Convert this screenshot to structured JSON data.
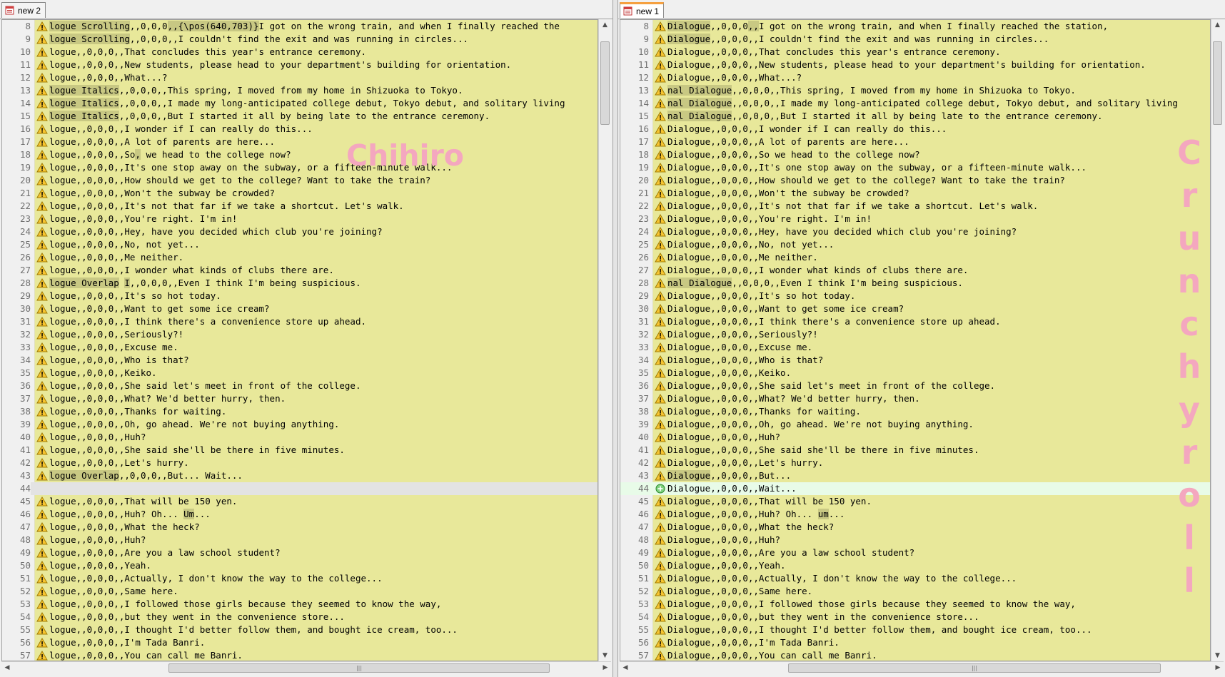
{
  "left": {
    "tab_label": "new 2",
    "watermark": "Chihiro",
    "lines": [
      {
        "n": "8",
        "segs": [
          [
            "logue Scrolling",
            1
          ],
          [
            ",,0,0,0",
            0
          ],
          [
            ",,{\\pos(640,703)}",
            1
          ],
          [
            "I got on the wrong train, and when I finally reached the",
            0
          ]
        ]
      },
      {
        "n": "9",
        "segs": [
          [
            "logue Scrolling",
            1
          ],
          [
            ",,0,0,0,,I couldn't find the exit and was running in circles...",
            0
          ]
        ]
      },
      {
        "n": "10",
        "segs": [
          [
            "logue,,0,0,0,,That concludes this year's entrance ceremony.",
            0
          ]
        ]
      },
      {
        "n": "11",
        "segs": [
          [
            "logue,,0,0,0,,New students, please head to your department's building for orientation.",
            0
          ]
        ]
      },
      {
        "n": "12",
        "segs": [
          [
            "logue,,0,0,0,,What...?",
            0
          ]
        ]
      },
      {
        "n": "13",
        "segs": [
          [
            "logue Italics",
            1
          ],
          [
            ",,0,0,0,,This spring, I moved from my home in Shizuoka to Tokyo.",
            0
          ]
        ]
      },
      {
        "n": "14",
        "segs": [
          [
            "logue Italics",
            1
          ],
          [
            ",,0,0,0,,I made my long-anticipated college debut, Tokyo debut, and solitary living",
            0
          ]
        ]
      },
      {
        "n": "15",
        "segs": [
          [
            "logue Italics",
            1
          ],
          [
            ",,0,0,0,,But I started it all by being late to the entrance ceremony.",
            0
          ]
        ]
      },
      {
        "n": "16",
        "segs": [
          [
            "logue,,0,0,0,,I wonder if I can really do this...",
            0
          ]
        ]
      },
      {
        "n": "17",
        "segs": [
          [
            "logue,,0,0,0,,A lot of parents are here...",
            0
          ]
        ]
      },
      {
        "n": "18",
        "segs": [
          [
            "logue,,0,0,0,,So",
            0
          ],
          [
            ",",
            1
          ],
          [
            " we head to the college now?",
            0
          ]
        ]
      },
      {
        "n": "19",
        "segs": [
          [
            "logue,,0,0,0,,It's one stop away on the subway, or a fifteen-minute walk...",
            0
          ]
        ]
      },
      {
        "n": "20",
        "segs": [
          [
            "logue,,0,0,0,,How should we get to the college? Want to take the train?",
            0
          ]
        ]
      },
      {
        "n": "21",
        "segs": [
          [
            "logue,,0,0,0,,Won't the subway be crowded?",
            0
          ]
        ]
      },
      {
        "n": "22",
        "segs": [
          [
            "logue,,0,0,0,,It's not that far if we take a shortcut. Let's walk.",
            0
          ]
        ]
      },
      {
        "n": "23",
        "segs": [
          [
            "logue,,0,0,0,,You're right. I'm in!",
            0
          ]
        ]
      },
      {
        "n": "24",
        "segs": [
          [
            "logue,,0,0,0,,Hey, have you decided which club you're joining?",
            0
          ]
        ]
      },
      {
        "n": "25",
        "segs": [
          [
            "logue,,0,0,0,,No, not yet...",
            0
          ]
        ]
      },
      {
        "n": "26",
        "segs": [
          [
            "logue,,0,0,0,,Me neither.",
            0
          ]
        ]
      },
      {
        "n": "27",
        "segs": [
          [
            "logue,,0,0,0,,I wonder what kinds of clubs there are.",
            0
          ]
        ]
      },
      {
        "n": "28",
        "segs": [
          [
            "logue Overlap",
            1
          ],
          [
            " ",
            0
          ],
          [
            "I",
            1
          ],
          [
            ",,0,0,0,,Even I think I'm being suspicious.",
            0
          ]
        ]
      },
      {
        "n": "29",
        "segs": [
          [
            "logue,,0,0,0,,It's so hot today.",
            0
          ]
        ]
      },
      {
        "n": "30",
        "segs": [
          [
            "logue,,0,0,0,,Want to get some ice cream?",
            0
          ]
        ]
      },
      {
        "n": "31",
        "segs": [
          [
            "logue,,0,0,0,,I think there's a convenience store up ahead.",
            0
          ]
        ]
      },
      {
        "n": "32",
        "segs": [
          [
            "logue,,0,0,0,,Seriously?!",
            0
          ]
        ]
      },
      {
        "n": "33",
        "segs": [
          [
            "logue,,0,0,0,,Excuse me.",
            0
          ]
        ]
      },
      {
        "n": "34",
        "segs": [
          [
            "logue,,0,0,0,,Who is that?",
            0
          ]
        ]
      },
      {
        "n": "35",
        "segs": [
          [
            "logue,,0,0,0,,Keiko.",
            0
          ]
        ]
      },
      {
        "n": "36",
        "segs": [
          [
            "logue,,0,0,0,,She said let's meet in front of the college.",
            0
          ]
        ]
      },
      {
        "n": "37",
        "segs": [
          [
            "logue,,0,0,0,,What? We'd better hurry, then.",
            0
          ]
        ]
      },
      {
        "n": "38",
        "segs": [
          [
            "logue,,0,0,0,,Thanks for waiting.",
            0
          ]
        ]
      },
      {
        "n": "39",
        "segs": [
          [
            "logue,,0,0,0,,Oh, go ahead. We're not buying anything.",
            0
          ]
        ]
      },
      {
        "n": "40",
        "segs": [
          [
            "logue,,0,0,0,,Huh?",
            0
          ]
        ]
      },
      {
        "n": "41",
        "segs": [
          [
            "logue,,0,0,0,,She said she'll be there in five minutes.",
            0
          ]
        ]
      },
      {
        "n": "42",
        "segs": [
          [
            "logue,,0,0,0,,Let's hurry.",
            0
          ]
        ]
      },
      {
        "n": "43",
        "segs": [
          [
            "logue Overlap",
            1
          ],
          [
            ",,0,0,0,,But... Wait...",
            0
          ]
        ]
      },
      {
        "n": "44",
        "kind": "empty",
        "segs": []
      },
      {
        "n": "45",
        "segs": [
          [
            "logue,,0,0,0,,That will be 150 yen.",
            0
          ]
        ]
      },
      {
        "n": "46",
        "segs": [
          [
            "logue,,0,0,0,,Huh? Oh... ",
            0
          ],
          [
            "Um",
            1
          ],
          [
            "...",
            0
          ]
        ]
      },
      {
        "n": "47",
        "segs": [
          [
            "logue,,0,0,0,,What the heck?",
            0
          ]
        ]
      },
      {
        "n": "48",
        "segs": [
          [
            "logue,,0,0,0,,Huh?",
            0
          ]
        ]
      },
      {
        "n": "49",
        "segs": [
          [
            "logue,,0,0,0,,Are you a law school student?",
            0
          ]
        ]
      },
      {
        "n": "50",
        "segs": [
          [
            "logue,,0,0,0,,Yeah.",
            0
          ]
        ]
      },
      {
        "n": "51",
        "segs": [
          [
            "logue,,0,0,0,,Actually, I don't know the way to the college...",
            0
          ]
        ]
      },
      {
        "n": "52",
        "segs": [
          [
            "logue,,0,0,0,,Same here.",
            0
          ]
        ]
      },
      {
        "n": "53",
        "segs": [
          [
            "logue,,0,0,0,,I followed those girls because they seemed to know the way,",
            0
          ]
        ]
      },
      {
        "n": "54",
        "segs": [
          [
            "logue,,0,0,0,,but they went in the convenience store...",
            0
          ]
        ]
      },
      {
        "n": "55",
        "segs": [
          [
            "logue,,0,0,0,,I thought I'd better follow them, and bought ice cream, too...",
            0
          ]
        ]
      },
      {
        "n": "56",
        "segs": [
          [
            "logue,,0,0,0,,I'm Tada Banri.",
            0
          ]
        ]
      },
      {
        "n": "57",
        "segs": [
          [
            "logue,,0,0,0,,You can call me Banri.",
            0
          ]
        ]
      }
    ]
  },
  "right": {
    "tab_label": "new 1",
    "watermark": [
      "C",
      "r",
      "u",
      "n",
      "c",
      "h",
      "y",
      "r",
      "o",
      "l",
      "l"
    ],
    "lines": [
      {
        "n": "8",
        "segs": [
          [
            "Dialogue",
            1
          ],
          [
            ",,0,0,0",
            0
          ],
          [
            ",,",
            1
          ],
          [
            "I got on the wrong train, and when I finally reached the station,",
            0
          ]
        ]
      },
      {
        "n": "9",
        "segs": [
          [
            "Dialogue",
            1
          ],
          [
            ",,0,0,0,,I couldn't find the exit and was running in circles...",
            0
          ]
        ]
      },
      {
        "n": "10",
        "segs": [
          [
            "Dialogue,,0,0,0,,That concludes this year's entrance ceremony.",
            0
          ]
        ]
      },
      {
        "n": "11",
        "segs": [
          [
            "Dialogue,,0,0,0,,New students, please head to your department's building for orientation.",
            0
          ]
        ]
      },
      {
        "n": "12",
        "segs": [
          [
            "Dialogue,,0,0,0,,What...?",
            0
          ]
        ]
      },
      {
        "n": "13",
        "segs": [
          [
            "nal Dialogue",
            1
          ],
          [
            ",,0,0,0,,This spring, I moved from my home in Shizuoka to Tokyo.",
            0
          ]
        ]
      },
      {
        "n": "14",
        "segs": [
          [
            "nal Dialogue",
            1
          ],
          [
            ",,0,0,0,,I made my long-anticipated college debut, Tokyo debut, and solitary living",
            0
          ]
        ]
      },
      {
        "n": "15",
        "segs": [
          [
            "nal Dialogue",
            1
          ],
          [
            ",,0,0,0,,But I started it all by being late to the entrance ceremony.",
            0
          ]
        ]
      },
      {
        "n": "16",
        "segs": [
          [
            "Dialogue,,0,0,0,,I wonder if I can really do this...",
            0
          ]
        ]
      },
      {
        "n": "17",
        "segs": [
          [
            "Dialogue,,0,0,0,,A lot of parents are here...",
            0
          ]
        ]
      },
      {
        "n": "18",
        "segs": [
          [
            "Dialogue,,0,0,0,,So we head to the college now?",
            0
          ]
        ]
      },
      {
        "n": "19",
        "segs": [
          [
            "Dialogue,,0,0,0,,It's one stop away on the subway, or a fifteen-minute walk...",
            0
          ]
        ]
      },
      {
        "n": "20",
        "segs": [
          [
            "Dialogue,,0,0,0,,How should we get to the college? Want to take the train?",
            0
          ]
        ]
      },
      {
        "n": "21",
        "segs": [
          [
            "Dialogue,,0,0,0,,Won't the subway be crowded?",
            0
          ]
        ]
      },
      {
        "n": "22",
        "segs": [
          [
            "Dialogue,,0,0,0,,It's not that far if we take a shortcut. Let's walk.",
            0
          ]
        ]
      },
      {
        "n": "23",
        "segs": [
          [
            "Dialogue,,0,0,0,,You're right. I'm in!",
            0
          ]
        ]
      },
      {
        "n": "24",
        "segs": [
          [
            "Dialogue,,0,0,0,,Hey, have you decided which club you're joining?",
            0
          ]
        ]
      },
      {
        "n": "25",
        "segs": [
          [
            "Dialogue,,0,0,0,,No, not yet...",
            0
          ]
        ]
      },
      {
        "n": "26",
        "segs": [
          [
            "Dialogue,,0,0,0,,Me neither.",
            0
          ]
        ]
      },
      {
        "n": "27",
        "segs": [
          [
            "Dialogue,,0,0,0,,I wonder what kinds of clubs there are.",
            0
          ]
        ]
      },
      {
        "n": "28",
        "segs": [
          [
            "nal Dialogue",
            1
          ],
          [
            ",,0,0,0,,Even I think I'm being suspicious.",
            0
          ]
        ]
      },
      {
        "n": "29",
        "segs": [
          [
            "Dialogue,,0,0,0,,It's so hot today.",
            0
          ]
        ]
      },
      {
        "n": "30",
        "segs": [
          [
            "Dialogue,,0,0,0,,Want to get some ice cream?",
            0
          ]
        ]
      },
      {
        "n": "31",
        "segs": [
          [
            "Dialogue,,0,0,0,,I think there's a convenience store up ahead.",
            0
          ]
        ]
      },
      {
        "n": "32",
        "segs": [
          [
            "Dialogue,,0,0,0,,Seriously?!",
            0
          ]
        ]
      },
      {
        "n": "33",
        "segs": [
          [
            "Dialogue,,0,0,0,,Excuse me.",
            0
          ]
        ]
      },
      {
        "n": "34",
        "segs": [
          [
            "Dialogue,,0,0,0,,Who is that?",
            0
          ]
        ]
      },
      {
        "n": "35",
        "segs": [
          [
            "Dialogue,,0,0,0,,Keiko.",
            0
          ]
        ]
      },
      {
        "n": "36",
        "segs": [
          [
            "Dialogue,,0,0,0,,She said let's meet in front of the college.",
            0
          ]
        ]
      },
      {
        "n": "37",
        "segs": [
          [
            "Dialogue,,0,0,0,,What? We'd better hurry, then.",
            0
          ]
        ]
      },
      {
        "n": "38",
        "segs": [
          [
            "Dialogue,,0,0,0,,Thanks for waiting.",
            0
          ]
        ]
      },
      {
        "n": "39",
        "segs": [
          [
            "Dialogue,,0,0,0,,Oh, go ahead. We're not buying anything.",
            0
          ]
        ]
      },
      {
        "n": "40",
        "segs": [
          [
            "Dialogue,,0,0,0,,Huh?",
            0
          ]
        ]
      },
      {
        "n": "41",
        "segs": [
          [
            "Dialogue,,0,0,0,,She said she'll be there in five minutes.",
            0
          ]
        ]
      },
      {
        "n": "42",
        "segs": [
          [
            "Dialogue,,0,0,0,,Let's hurry.",
            0
          ]
        ]
      },
      {
        "n": "43",
        "segs": [
          [
            "Dialogue",
            1
          ],
          [
            ",,0,0,0,,But...",
            0
          ]
        ]
      },
      {
        "n": "44",
        "kind": "added",
        "segs": [
          [
            "Dialogue,,0,0,0,,Wait...",
            0
          ]
        ]
      },
      {
        "n": "45",
        "segs": [
          [
            "Dialogue,,0,0,0,,That will be 150 yen.",
            0
          ]
        ]
      },
      {
        "n": "46",
        "segs": [
          [
            "Dialogue,,0,0,0,,Huh? Oh... ",
            0
          ],
          [
            "um",
            1
          ],
          [
            "...",
            0
          ]
        ]
      },
      {
        "n": "47",
        "segs": [
          [
            "Dialogue,,0,0,0,,What the heck?",
            0
          ]
        ]
      },
      {
        "n": "48",
        "segs": [
          [
            "Dialogue,,0,0,0,,Huh?",
            0
          ]
        ]
      },
      {
        "n": "49",
        "segs": [
          [
            "Dialogue,,0,0,0,,Are you a law school student?",
            0
          ]
        ]
      },
      {
        "n": "50",
        "segs": [
          [
            "Dialogue,,0,0,0,,Yeah.",
            0
          ]
        ]
      },
      {
        "n": "51",
        "segs": [
          [
            "Dialogue,,0,0,0,,Actually, I don't know the way to the college...",
            0
          ]
        ]
      },
      {
        "n": "52",
        "segs": [
          [
            "Dialogue,,0,0,0,,Same here.",
            0
          ]
        ]
      },
      {
        "n": "53",
        "segs": [
          [
            "Dialogue,,0,0,0,,I followed those girls because they seemed to know the way,",
            0
          ]
        ]
      },
      {
        "n": "54",
        "segs": [
          [
            "Dialogue,,0,0,0,,but they went in the convenience store...",
            0
          ]
        ]
      },
      {
        "n": "55",
        "segs": [
          [
            "Dialogue,,0,0,0,,I thought I'd better follow them, and bought ice cream, too...",
            0
          ]
        ]
      },
      {
        "n": "56",
        "segs": [
          [
            "Dialogue,,0,0,0,,I'm Tada Banri.",
            0
          ]
        ]
      },
      {
        "n": "57",
        "segs": [
          [
            "Dialogue,,0,0,0,,You can call me Banri.",
            0
          ]
        ]
      }
    ]
  },
  "icons": {
    "tab": "notepad-file-icon",
    "changed_line": "warning-triangle-icon",
    "added_line": "plus-circle-icon",
    "scroll_up": "up-arrow-icon",
    "scroll_down": "down-arrow-icon",
    "scroll_left": "left-arrow-icon",
    "scroll_right": "right-arrow-icon"
  },
  "colors": {
    "diff_changed_bg": "#e8e89a",
    "diff_highlight": "#c8c883",
    "diff_added_bg": "#e8fbe8",
    "diff_empty_bg": "#e3e3e3",
    "watermark": "#f4a7bf",
    "tab_accent": "#f5a040"
  }
}
